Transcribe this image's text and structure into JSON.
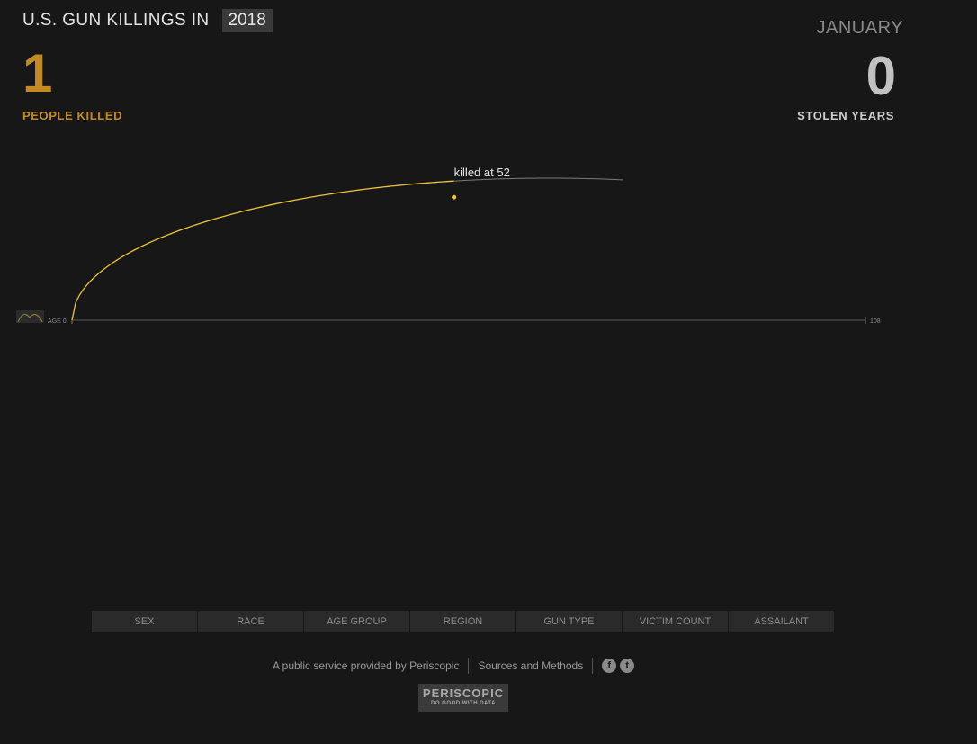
{
  "header": {
    "title": "U.S. GUN KILLINGS IN",
    "year": "2018"
  },
  "stats": {
    "people_killed_count": "1",
    "people_killed_label": "PEOPLE KILLED",
    "month": "JANUARY",
    "stolen_years_count": "0",
    "stolen_years_label": "STOLEN YEARS"
  },
  "chart_data": {
    "type": "line",
    "x_axis": {
      "min_label": "AGE 0",
      "max_label": "108",
      "range": [
        0,
        108
      ]
    },
    "victims": [
      {
        "age_killed": 52,
        "label": "killed at 52",
        "color": "#f0c33c"
      }
    ]
  },
  "tabs": [
    "SEX",
    "RACE",
    "AGE GROUP",
    "REGION",
    "GUN TYPE",
    "VICTIM COUNT",
    "ASSAILANT"
  ],
  "footer": {
    "service_text": "A public service provided by",
    "provider_link": "Periscopic",
    "sources_link": "Sources and Methods",
    "social_icons": [
      "facebook-icon",
      "twitter-icon"
    ]
  },
  "logo": {
    "name": "PERISCOPIC",
    "tagline": "DO GOOD WITH DATA"
  }
}
